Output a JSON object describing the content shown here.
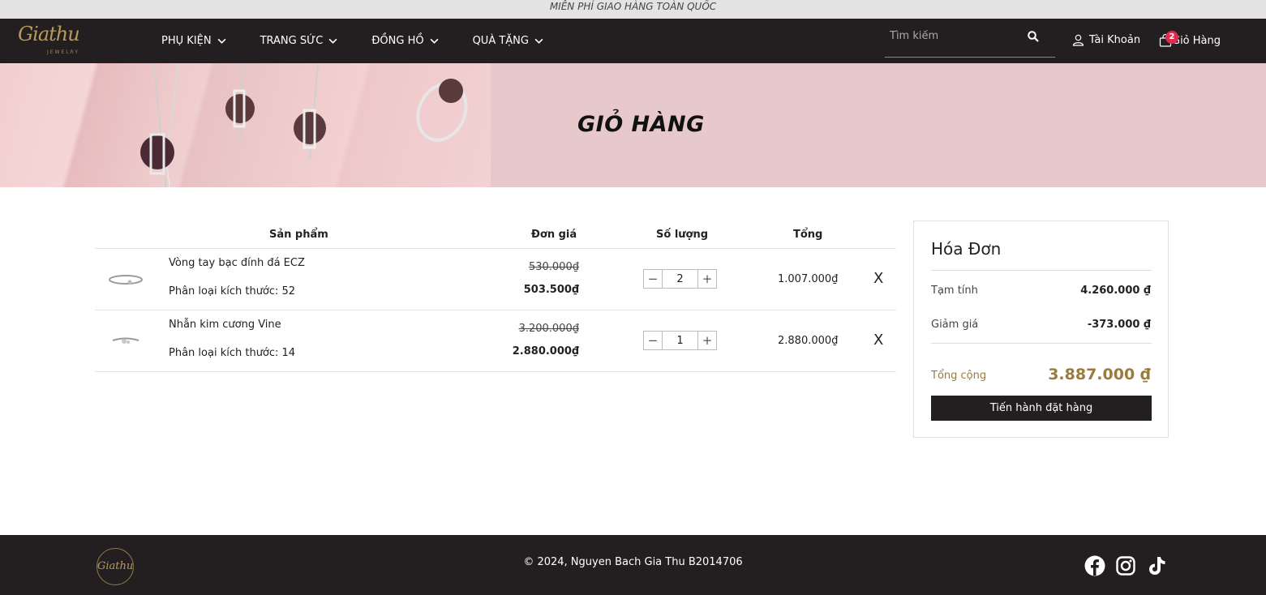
{
  "topbar": {
    "promo": "MIỄN PHÍ GIAO HÀNG TOÀN QUỐC"
  },
  "nav": {
    "logo_script": "Giathu",
    "logo_sub": "JEWELRY",
    "menu": [
      {
        "label": "PHỤ KIỆN"
      },
      {
        "label": "TRANG SỨC"
      },
      {
        "label": "ĐỒNG HỒ"
      },
      {
        "label": "QUÀ TẶNG"
      }
    ],
    "search_placeholder": "Tìm kiếm",
    "account_label": "Tài Khoản",
    "cart_label": "Giỏ Hàng",
    "cart_count": "2"
  },
  "banner": {
    "title": "GIỎ HÀNG"
  },
  "table": {
    "headers": {
      "product": "Sản phẩm",
      "price": "Đơn giá",
      "qty": "Số lượng",
      "total": "Tổng"
    },
    "rows": [
      {
        "name": "Vòng tay bạc đính đá ECZ",
        "variant": "Phân loại kích thước: 52",
        "old_price": "530.000₫",
        "price": "503.500₫",
        "qty": "2",
        "total": "1.007.000₫",
        "remove": "X"
      },
      {
        "name": "Nhẫn kim cương Vine",
        "variant": "Phân loại kích thước: 14",
        "old_price": "3.200.000₫",
        "price": "2.880.000₫",
        "qty": "1",
        "total": "2.880.000₫",
        "remove": "X"
      }
    ],
    "minus": "−",
    "plus": "+"
  },
  "invoice": {
    "title": "Hóa Đơn",
    "subtotal_label": "Tạm tính",
    "subtotal": "4.260.000 ₫",
    "discount_label": "Giảm giá",
    "discount": "-373.000 ₫",
    "grand_label": "Tổng cộng",
    "grand": "3.887.000 ₫",
    "checkout_label": "Tiến hành đặt hàng"
  },
  "footer": {
    "logo_script": "Giathu",
    "copyright": "© 2024, Nguyen Bach Gia Thu B2014706",
    "social": [
      "facebook-icon",
      "instagram-icon",
      "tiktok-icon"
    ]
  },
  "colors": {
    "dark": "#231f20",
    "accent": "#9a7b3c",
    "banner": "#e8c9cb",
    "badge": "#e02b4a"
  }
}
